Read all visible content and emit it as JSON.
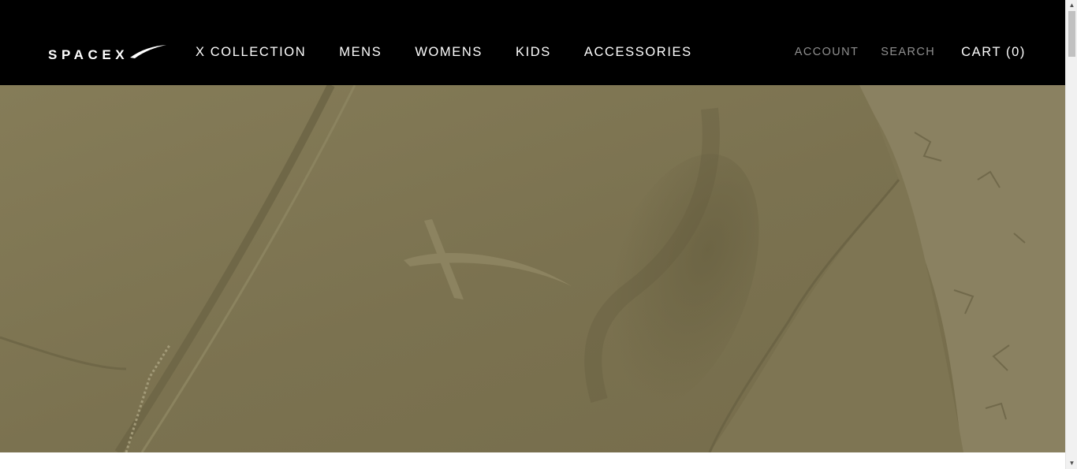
{
  "header": {
    "logo": {
      "text": "SPACEX",
      "icon": "spacex-logo"
    },
    "nav": [
      {
        "label": "X COLLECTION"
      },
      {
        "label": "MENS"
      },
      {
        "label": "WOMENS"
      },
      {
        "label": "KIDS"
      },
      {
        "label": "ACCESSORIES"
      }
    ],
    "account_label": "ACCOUNT",
    "search_label": "SEARCH",
    "cart_label": "CART (0)"
  },
  "hero": {
    "image": "olive-hoodie-with-x-logo-on-dirt",
    "colors": {
      "fabric": "#7b7250",
      "background": "#000000"
    }
  },
  "scrollbar": {
    "up_icon": "triangle-up-icon",
    "down_icon": "triangle-down-icon"
  }
}
